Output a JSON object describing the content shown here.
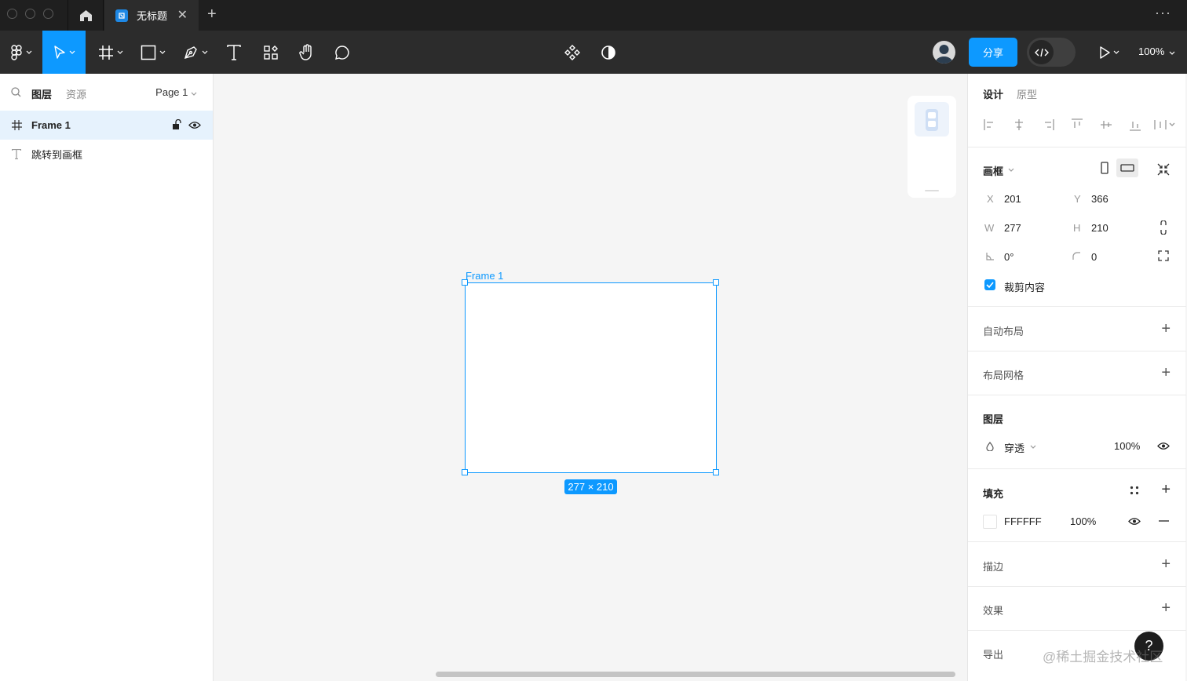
{
  "titlebar": {
    "tab_title": "无标题",
    "close_glyph": "✕",
    "add_glyph": "+",
    "more_glyph": "···"
  },
  "toolbar": {
    "share_label": "分享",
    "zoom": "100%",
    "accent_color": "#0d99ff"
  },
  "left_panel": {
    "tabs": [
      "图层",
      "资源"
    ],
    "page": "Page 1",
    "layers": [
      {
        "name": "Frame 1",
        "type": "frame",
        "selected": true
      },
      {
        "name": "跳转到画框",
        "type": "text",
        "selected": false
      }
    ]
  },
  "canvas": {
    "frame_label": "Frame 1",
    "size_badge": "277 × 210"
  },
  "right_panel": {
    "tabs": [
      "设计",
      "原型"
    ],
    "frame_section": {
      "title": "画框",
      "x_label": "X",
      "x_value": "201",
      "y_label": "Y",
      "y_value": "366",
      "w_label": "W",
      "w_value": "277",
      "h_label": "H",
      "h_value": "210",
      "rotation": "0°",
      "radius": "0",
      "clip_label": "裁剪内容",
      "clip_checked": true
    },
    "auto_layout": "自动布局",
    "layout_grid": "布局网格",
    "layer_section": {
      "title": "图层",
      "blend": "穿透",
      "opacity": "100%"
    },
    "fill_section": {
      "title": "填充",
      "color": "FFFFFF",
      "opacity": "100%"
    },
    "stroke": "描边",
    "effects": "效果",
    "export": "导出"
  },
  "help_label": "?",
  "watermark": "@稀土掘金技术社区"
}
